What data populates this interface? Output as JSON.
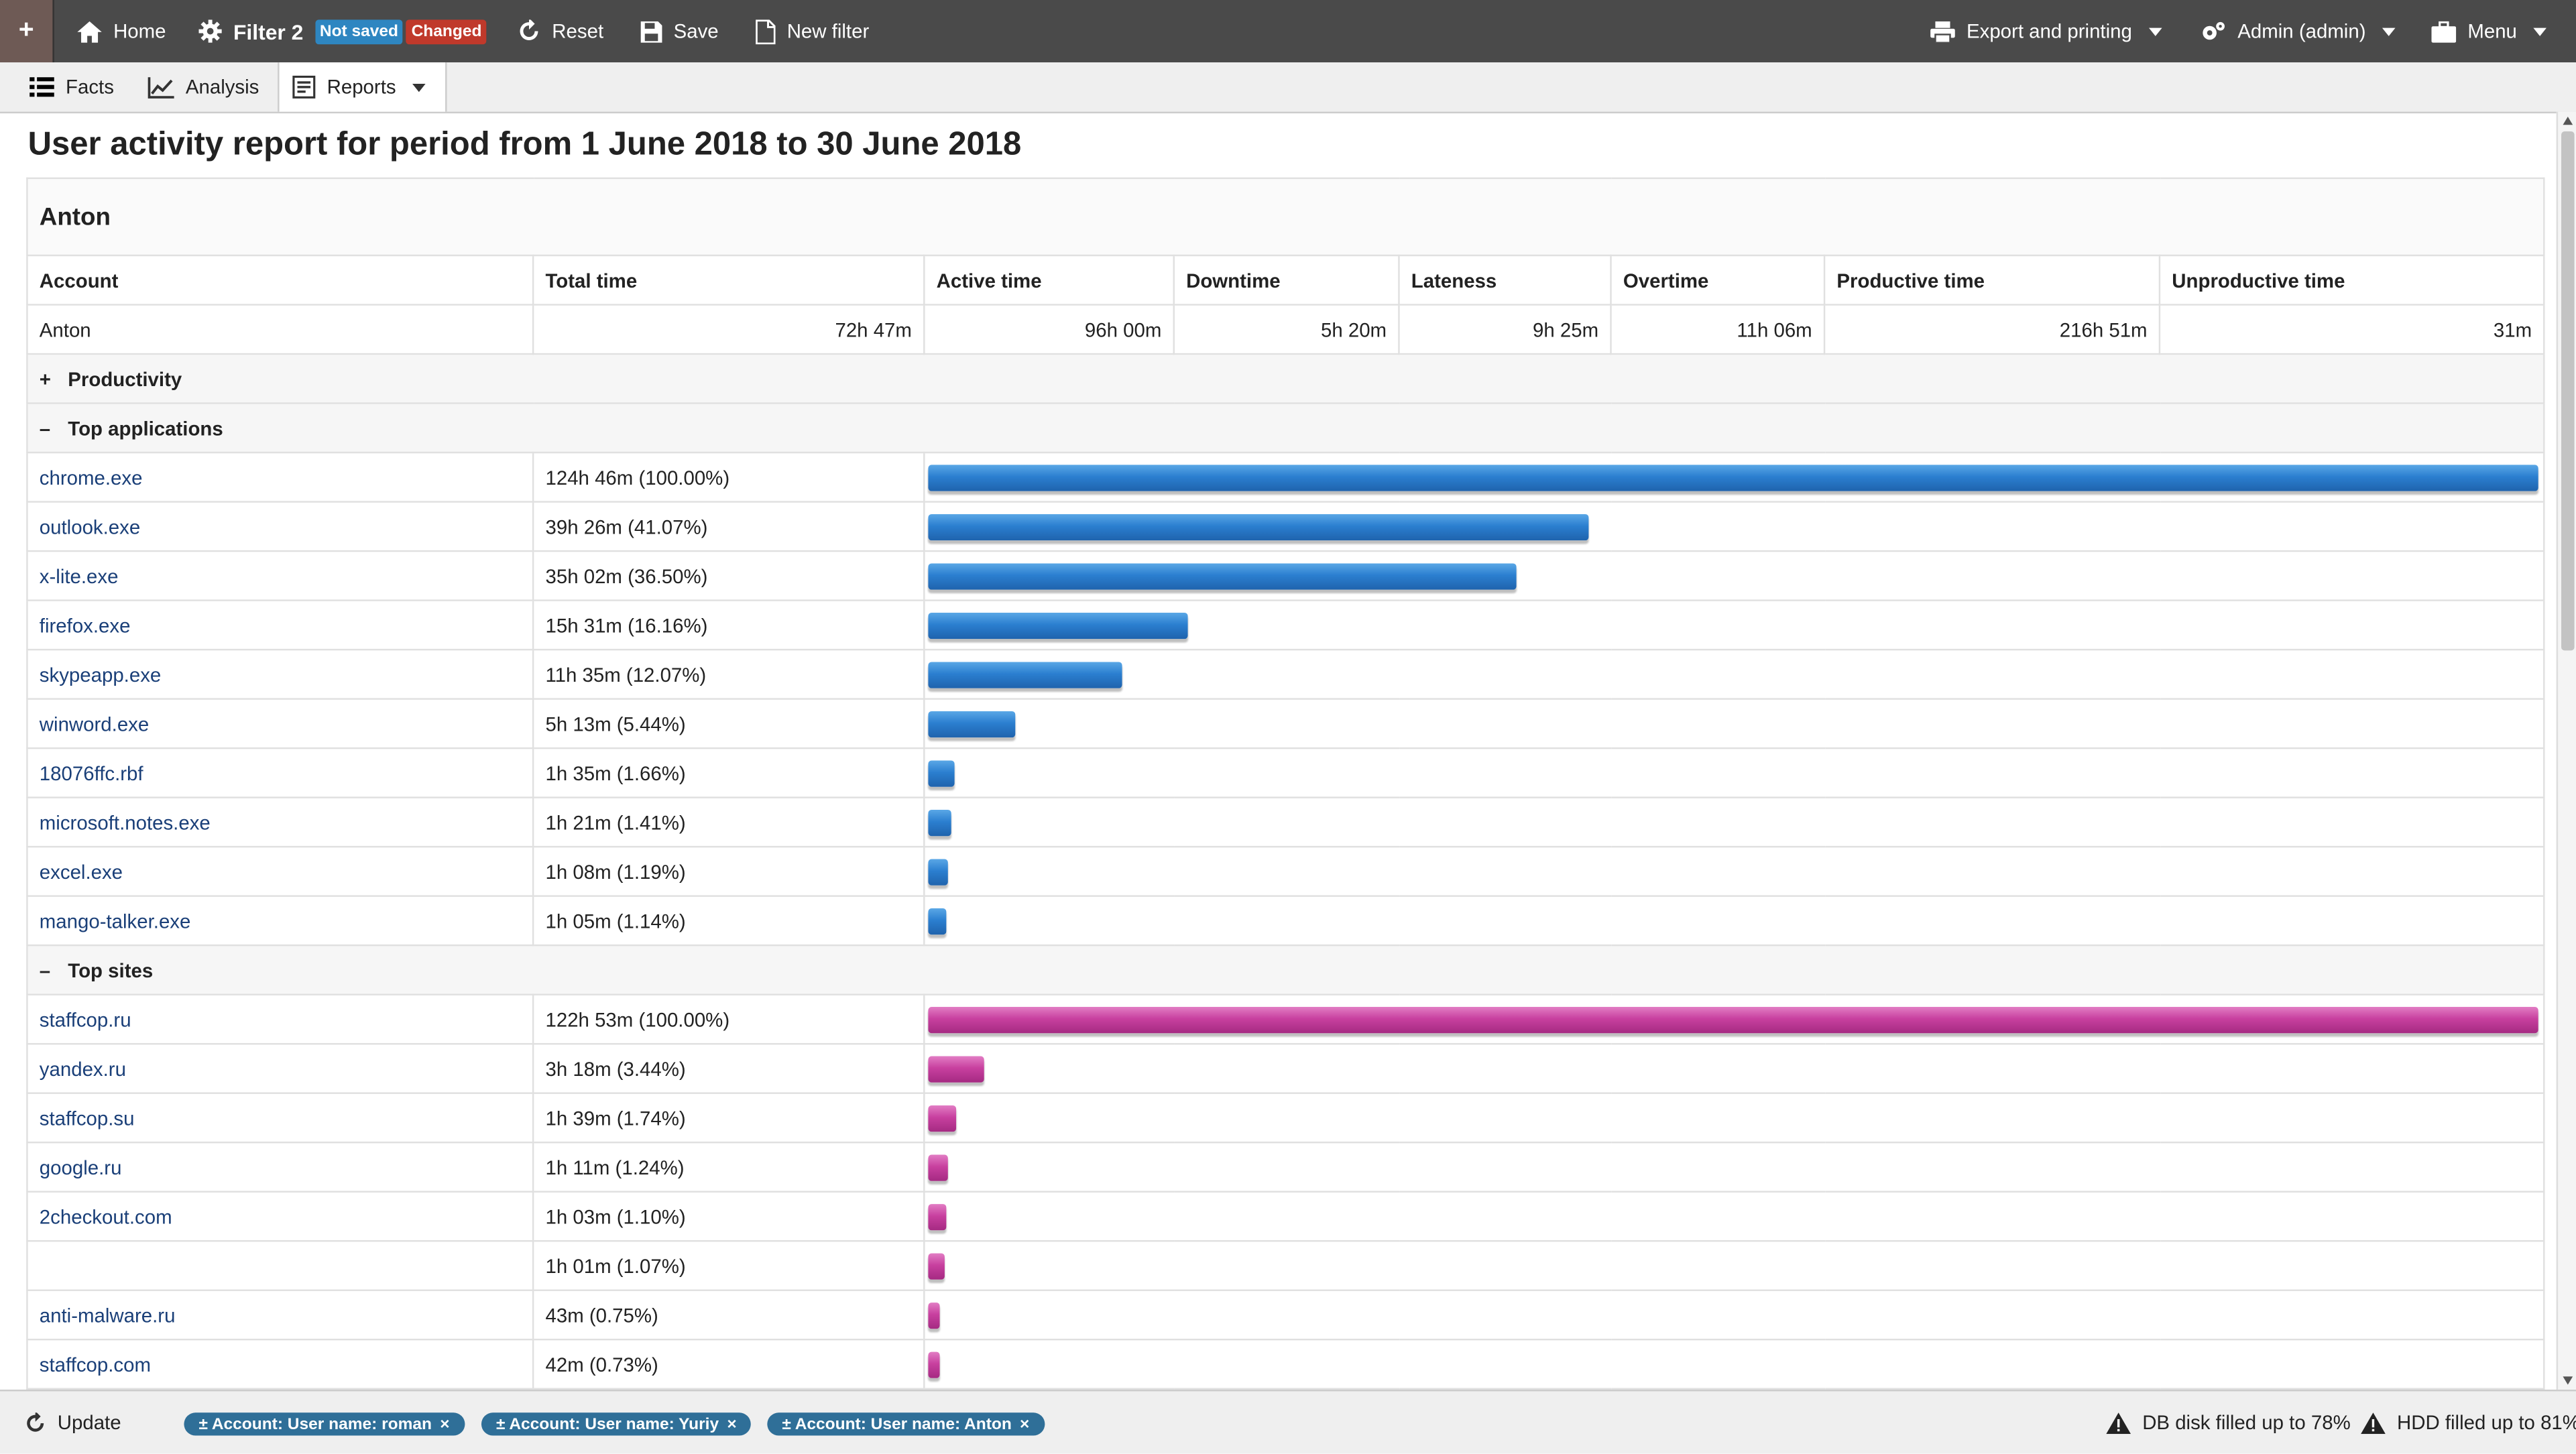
{
  "topbar": {
    "add_label": "+",
    "home_label": "Home",
    "filter_label": "Filter 2",
    "badge_not_saved": "Not saved",
    "badge_changed": "Changed",
    "reset_label": "Reset",
    "save_label": "Save",
    "new_filter_label": "New filter",
    "export_label": "Export and printing",
    "admin_label": "Admin (admin)",
    "menu_label": "Menu"
  },
  "subnav": {
    "facts_label": "Facts",
    "analysis_label": "Analysis",
    "reports_label": "Reports"
  },
  "report": {
    "title": "User activity report for period from 1 June 2018 to 30 June 2018",
    "user": "Anton",
    "columns": [
      "Account",
      "Total time",
      "Active time",
      "Downtime",
      "Lateness",
      "Overtime",
      "Productive time",
      "Unproductive time"
    ],
    "totals": [
      "Anton",
      "72h 47m",
      "96h 00m",
      "5h 20m",
      "9h 25m",
      "11h 06m",
      "216h 51m",
      "31m"
    ],
    "productivity_label": "Productivity",
    "productivity_sign": "+",
    "apps_label": "Top applications",
    "apps_sign": "–",
    "sites_label": "Top sites",
    "sites_sign": "–",
    "apps": [
      {
        "name": "chrome.exe",
        "time": "124h 46m (100.00%)",
        "pct": 100.0
      },
      {
        "name": "outlook.exe",
        "time": "39h 26m (41.07%)",
        "pct": 41.07
      },
      {
        "name": "x-lite.exe",
        "time": "35h 02m (36.50%)",
        "pct": 36.5
      },
      {
        "name": "firefox.exe",
        "time": "15h 31m (16.16%)",
        "pct": 16.16
      },
      {
        "name": "skypeapp.exe",
        "time": "11h 35m (12.07%)",
        "pct": 12.07
      },
      {
        "name": "winword.exe",
        "time": "5h 13m (5.44%)",
        "pct": 5.44
      },
      {
        "name": "18076ffc.rbf",
        "time": "1h 35m (1.66%)",
        "pct": 1.66
      },
      {
        "name": "microsoft.notes.exe",
        "time": "1h 21m (1.41%)",
        "pct": 1.41
      },
      {
        "name": "excel.exe",
        "time": "1h 08m (1.19%)",
        "pct": 1.19
      },
      {
        "name": "mango-talker.exe",
        "time": "1h 05m (1.14%)",
        "pct": 1.14
      }
    ],
    "sites": [
      {
        "name": "staffcop.ru",
        "time": "122h 53m (100.00%)",
        "pct": 100.0
      },
      {
        "name": "yandex.ru",
        "time": "3h 18m (3.44%)",
        "pct": 3.44
      },
      {
        "name": "staffcop.su",
        "time": "1h 39m (1.74%)",
        "pct": 1.74
      },
      {
        "name": "google.ru",
        "time": "1h 11m (1.24%)",
        "pct": 1.24
      },
      {
        "name": "2checkout.com",
        "time": "1h 03m (1.10%)",
        "pct": 1.1
      },
      {
        "name": "",
        "time": "1h 01m (1.07%)",
        "pct": 1.07
      },
      {
        "name": "anti-malware.ru",
        "time": "43m (0.75%)",
        "pct": 0.75
      },
      {
        "name": "staffcop.com",
        "time": "42m (0.73%)",
        "pct": 0.73
      }
    ],
    "colors": {
      "apps_bar": "#2b7fd0",
      "sites_bar": "#c8409f"
    }
  },
  "bottombar": {
    "update_label": "Update",
    "chips": [
      "± Account: User name: roman",
      "± Account: User name: Yuriy",
      "± Account: User name: Anton"
    ],
    "chip_close": "×",
    "db_status": "DB disk filled up to 78%",
    "hdd_status": "HDD filled up to 81%"
  }
}
